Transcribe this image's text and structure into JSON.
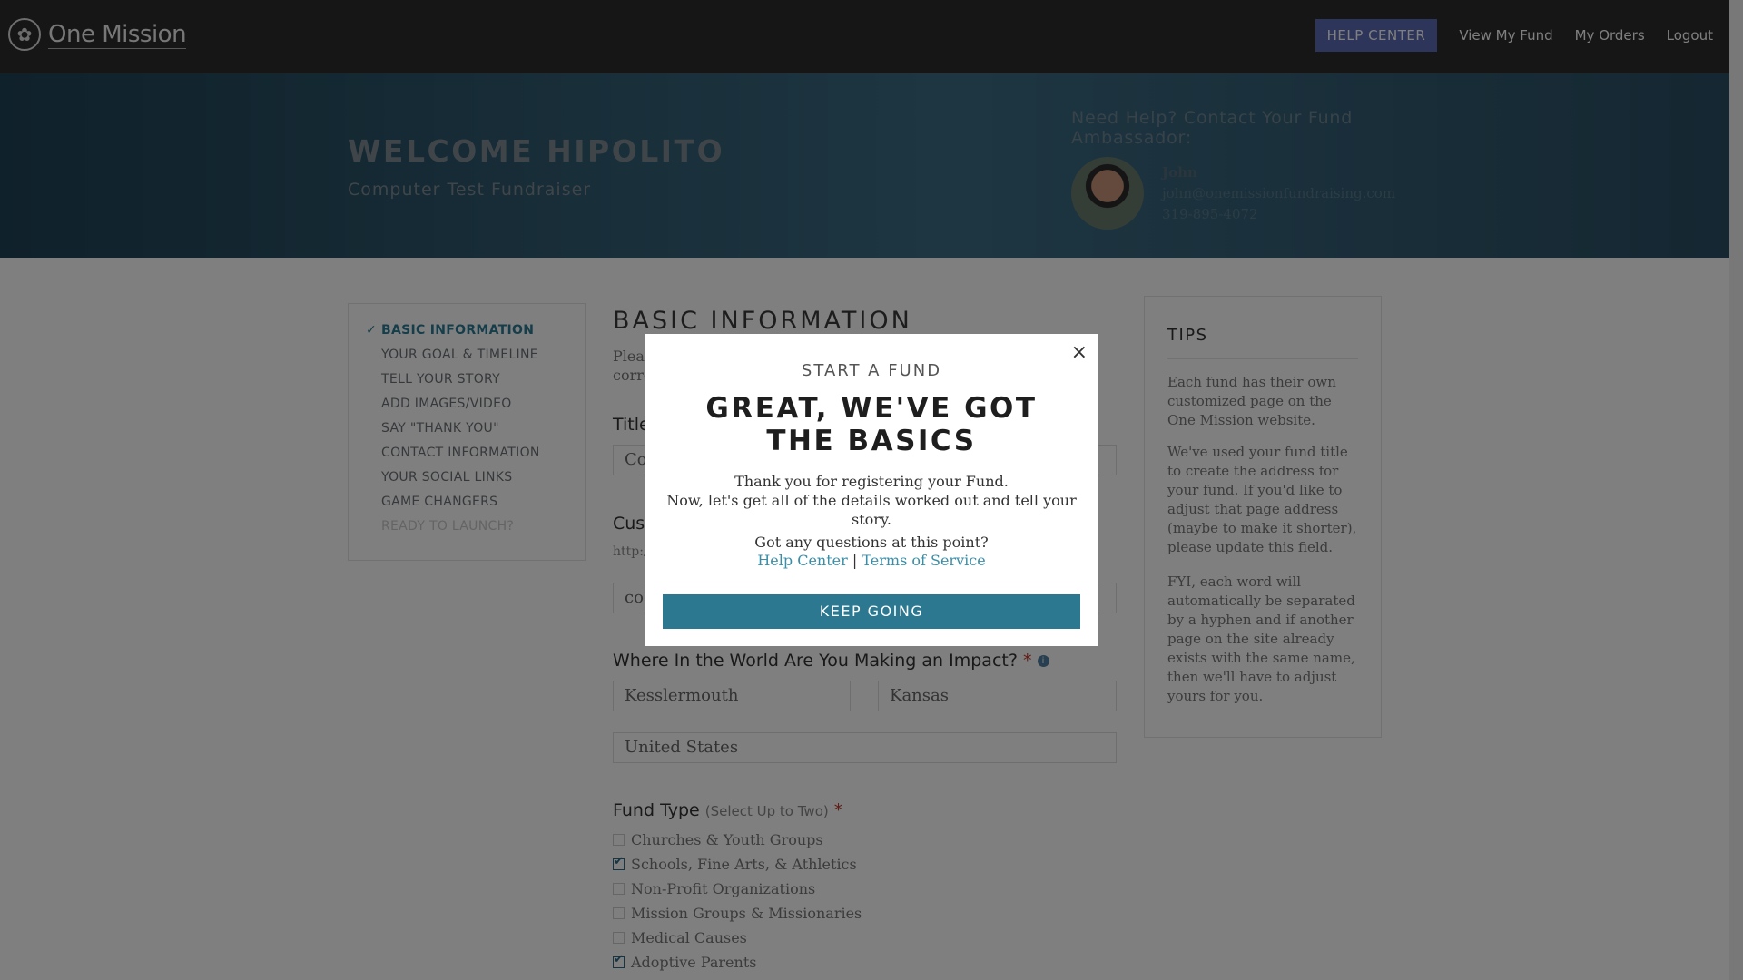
{
  "topnav": {
    "logo_text": "One Mission",
    "help_center": "HELP CENTER",
    "view_my_fund": "View My Fund",
    "my_orders": "My Orders",
    "logout": "Logout"
  },
  "banner": {
    "welcome": "WELCOME HIPOLITO",
    "subtitle": "Computer Test Fundraiser",
    "need_help": "Need Help? Contact Your Fund Ambassador:",
    "ambassador_name": "John",
    "ambassador_email": "john@onemissionfundraising.com",
    "ambassador_phone": "319-895-4072"
  },
  "sidebar": {
    "steps": [
      {
        "label": "BASIC INFORMATION",
        "state": "active",
        "check": "✓"
      },
      {
        "label": "YOUR GOAL & TIMELINE",
        "state": "normal"
      },
      {
        "label": "TELL YOUR STORY",
        "state": "normal"
      },
      {
        "label": "ADD IMAGES/VIDEO",
        "state": "normal"
      },
      {
        "label": "SAY \"THANK YOU\"",
        "state": "normal"
      },
      {
        "label": "CONTACT INFORMATION",
        "state": "normal"
      },
      {
        "label": "YOUR SOCIAL LINKS",
        "state": "normal"
      },
      {
        "label": "GAME CHANGERS",
        "state": "normal"
      },
      {
        "label": "READY TO LAUNCH?",
        "state": "disabled"
      }
    ]
  },
  "form": {
    "heading": "BASIC INFORMATION",
    "intro": "Please",
    "intro2": "corre",
    "title_label": "Title",
    "title_value": "Co",
    "custom_label": "Cus",
    "url_prefix": "http:/",
    "custom_value": "co",
    "location_label": "Where In the World Are You Making an Impact?",
    "required_mark": "*",
    "info_icon_glyph": "i",
    "city": "Kesslermouth",
    "state": "Kansas",
    "country": "United States",
    "fund_type_label": "Fund Type",
    "fund_type_hint": "(Select Up to Two)",
    "fund_types": [
      {
        "label": "Churches & Youth Groups",
        "checked": false
      },
      {
        "label": "Schools, Fine Arts, & Athletics",
        "checked": true
      },
      {
        "label": "Non-Profit Organizations",
        "checked": false
      },
      {
        "label": "Mission Groups & Missionaries",
        "checked": false
      },
      {
        "label": "Medical Causes",
        "checked": false
      },
      {
        "label": "Adoptive Parents",
        "checked": true
      }
    ]
  },
  "tips": {
    "title": "TIPS",
    "p1": "Each fund has their own customized page on the One Mission website.",
    "p2": "We've used your fund title to create the address for your fund. If you'd like to adjust that page address (maybe to make it shorter), please update this field.",
    "p3": "FYI, each word will automatically be separated by a hyphen and if another page on the site already exists with the same name, then we'll have to adjust yours for you."
  },
  "modal": {
    "close": "×",
    "kicker": "START A FUND",
    "headline": "GREAT, WE'VE GOT THE BASICS",
    "body_line1": "Thank you for registering your Fund.",
    "body_line2": "Now, let's get all of the details worked out and tell your story.",
    "questions": "Got any questions at this point?",
    "help_link": "Help Center",
    "separator": "|",
    "terms_link": "Terms of Service",
    "cta": "KEEP GOING"
  },
  "colors": {
    "nav_bg": "#2c2c2c",
    "help_button": "#5d6bb7",
    "accent_teal": "#2b7890",
    "link": "#3a8fa8"
  }
}
